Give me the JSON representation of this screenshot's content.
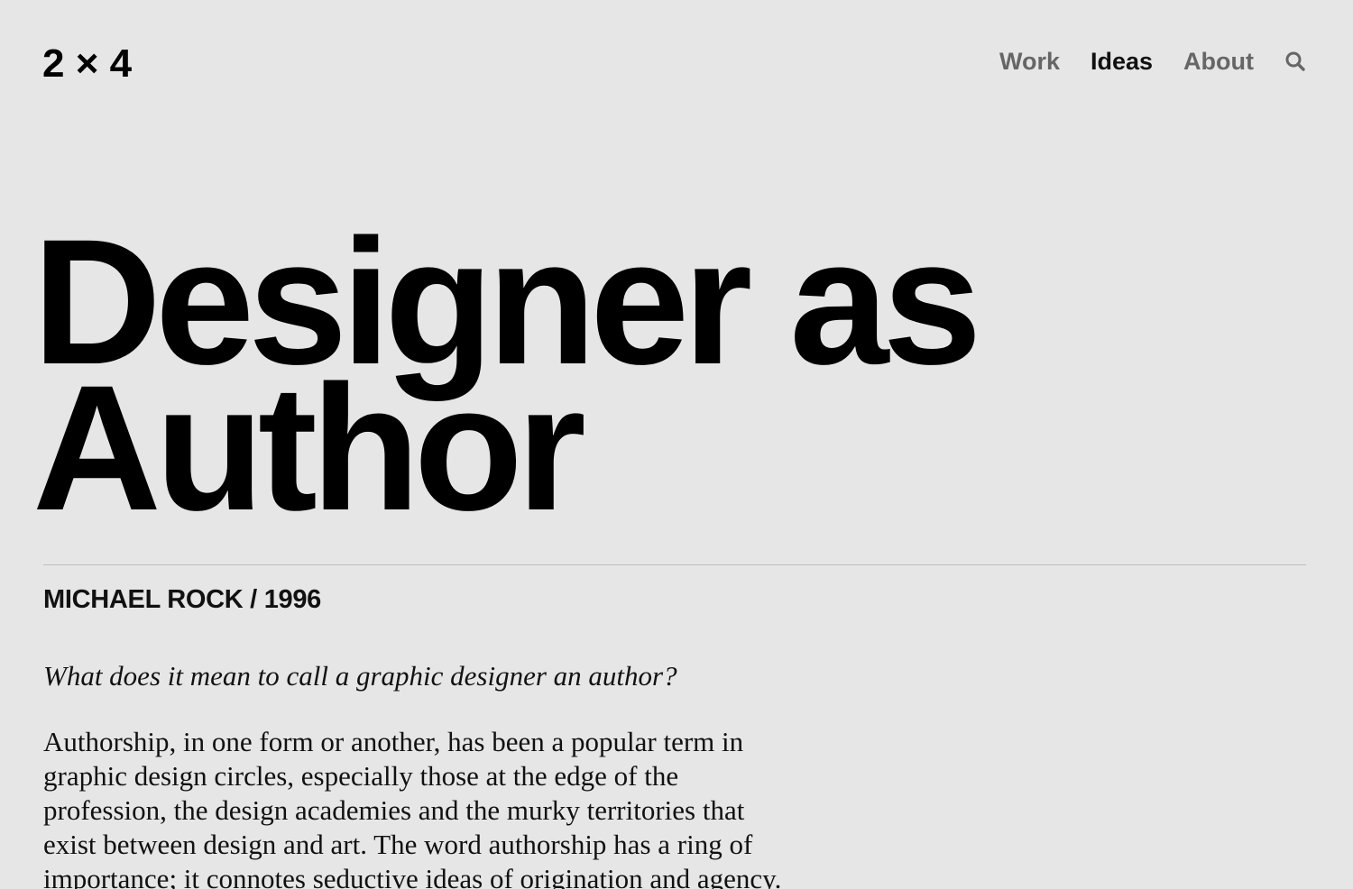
{
  "header": {
    "logo": "2 × 4",
    "nav": [
      {
        "label": "Work",
        "active": false
      },
      {
        "label": "Ideas",
        "active": true
      },
      {
        "label": "About",
        "active": false
      }
    ],
    "search_icon": "search-icon"
  },
  "article": {
    "title_line_1": "Designer as",
    "title_line_2": "Author",
    "byline": "MICHAEL ROCK / 1996",
    "lede": "What does it mean to call a graphic designer an author?",
    "body_lines": [
      "Authorship, in one form or another, has been a popular term in",
      "graphic design circles, especially those at the edge of the",
      "profession, the design academies and the murky territories that",
      "exist between design and art. The word authorship has a ring of",
      "importance; it connotes seductive ideas of origination and agency."
    ]
  },
  "colors": {
    "background": "#e6e6e6",
    "nav_inactive": "#666666",
    "nav_active": "#111111",
    "rule": "#bdbdbd"
  }
}
